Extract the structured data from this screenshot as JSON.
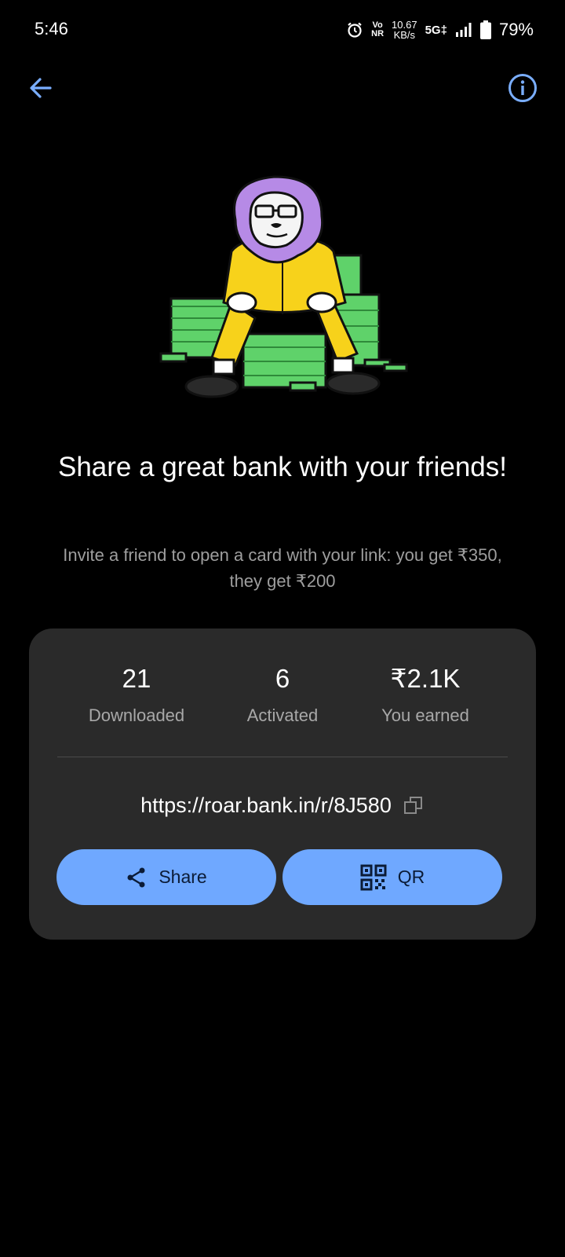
{
  "status_bar": {
    "time": "5:46",
    "volte_top": "Vo",
    "volte_bottom": "NR",
    "speed_value": "10.67",
    "speed_unit": "KB/s",
    "network": "5G‡",
    "battery": "79%"
  },
  "header": {
    "back_icon": "arrow-left-icon",
    "info_icon": "info-icon"
  },
  "main": {
    "headline": "Share a great bank with your friends!",
    "subtitle": "Invite a friend to open a card with your link: you get ₹350, they get ₹200"
  },
  "stats": [
    {
      "value": "21",
      "label": "Downloaded"
    },
    {
      "value": "6",
      "label": "Activated"
    },
    {
      "value": "₹2.1K",
      "label": "You earned"
    }
  ],
  "referral": {
    "link": "https://roar.bank.in/r/8J580",
    "copy_icon": "copy-icon"
  },
  "actions": {
    "share_label": "Share",
    "qr_label": "QR"
  },
  "colors": {
    "accent": "#6fa8ff",
    "card_bg": "#2a2a2a",
    "muted_text": "#9e9e9e"
  }
}
